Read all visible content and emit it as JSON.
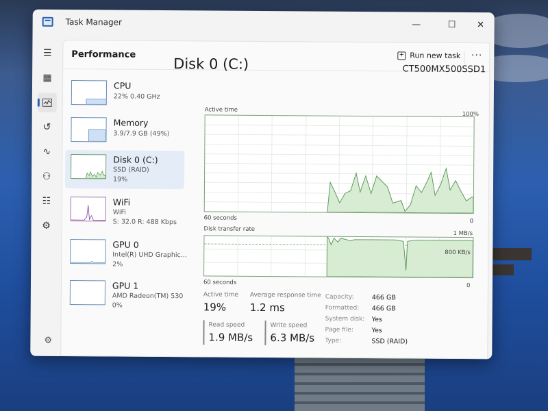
{
  "window": {
    "title": "Task Manager",
    "controls": {
      "minimize": "—",
      "maximize": "☐",
      "close": "✕"
    }
  },
  "nav_icons": [
    "hamburger-icon",
    "processes-icon",
    "performance-icon",
    "app-history-icon",
    "startup-apps-icon",
    "users-icon",
    "details-icon",
    "services-icon",
    "settings-icon"
  ],
  "header": {
    "title": "Performance",
    "run_new_task": "Run new task",
    "more": "···"
  },
  "devices": [
    {
      "name": "CPU",
      "line1": "22% 0.40 GHz",
      "line2": "",
      "line3": ""
    },
    {
      "name": "Memory",
      "line1": "3.9/7.9 GB (49%)",
      "line2": "",
      "line3": ""
    },
    {
      "name": "Disk 0 (C:)",
      "line1": "SSD (RAID)",
      "line2": "19%",
      "line3": ""
    },
    {
      "name": "WiFi",
      "line1": "WiFi",
      "line2": "S: 32.0  R: 488 Kbps",
      "line3": ""
    },
    {
      "name": "GPU 0",
      "line1": "Intel(R) UHD Graphic...",
      "line2": "2%",
      "line3": ""
    },
    {
      "name": "GPU 1",
      "line1": "AMD Radeon(TM) 530",
      "line2": "0%",
      "line3": ""
    }
  ],
  "main": {
    "title": "Disk 0 (C:)",
    "model": "CT500MX500SSD1",
    "active_time_graph": {
      "label": "Active time",
      "max": "100%",
      "time_span": "60 seconds",
      "min": "0"
    },
    "transfer_graph": {
      "label": "Disk transfer rate",
      "max": "1 MB/s",
      "mid": "800 KB/s",
      "time_span": "60 seconds",
      "min": "0"
    },
    "stats": {
      "active_time_label": "Active time",
      "active_time": "19%",
      "avg_response_label": "Average response time",
      "avg_response": "1.2 ms",
      "read_speed_label": "Read speed",
      "read_speed": "1.9 MB/s",
      "write_speed_label": "Write speed",
      "write_speed": "6.3 MB/s"
    },
    "properties": [
      {
        "key": "Capacity:",
        "value": "466 GB"
      },
      {
        "key": "Formatted:",
        "value": "466 GB"
      },
      {
        "key": "System disk:",
        "value": "Yes"
      },
      {
        "key": "Page file:",
        "value": "Yes"
      },
      {
        "key": "Type:",
        "value": "SSD (RAID)"
      }
    ]
  },
  "colors": {
    "disk_fill": "#d8ebd3",
    "disk_line": "#5d9a5d",
    "accent": "#2b5fb4"
  }
}
